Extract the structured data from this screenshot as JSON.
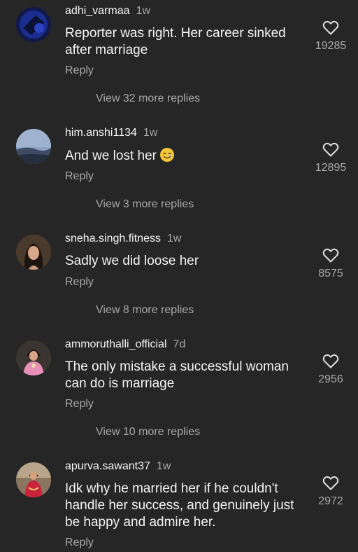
{
  "comments": [
    {
      "username": "adhi_varmaa",
      "time": "1w",
      "text": "Reporter was right. Her career sinked after marriage",
      "reply_label": "Reply",
      "likes": "19285",
      "view_more": "View 32 more replies",
      "avatar_icon": "avatar-dark-blue"
    },
    {
      "username": "him.anshi1134",
      "time": "1w",
      "text": "And we lost her",
      "emoji": "smiling-face-with-tear-emoji",
      "reply_label": "Reply",
      "likes": "12895",
      "view_more": "View 3 more replies",
      "avatar_icon": "avatar-sky"
    },
    {
      "username": "sneha.singh.fitness",
      "time": "1w",
      "text": "Sadly we did loose her",
      "reply_label": "Reply",
      "likes": "8575",
      "view_more": "View 8 more replies",
      "avatar_icon": "avatar-person"
    },
    {
      "username": "ammoruthalli_official",
      "time": "7d",
      "text": "The only mistake a successful woman can do is marriage",
      "reply_label": "Reply",
      "likes": "2956",
      "view_more": "View 10 more replies",
      "avatar_icon": "avatar-person-pink"
    },
    {
      "username": "apurva.sawant37",
      "time": "1w",
      "text": "Idk why he married her if he couldn't handle her success, and genuinely just be happy and admire her.",
      "reply_label": "Reply",
      "likes": "2972",
      "avatar_icon": "avatar-person-red"
    }
  ],
  "icons": {
    "like": "heart-outline-icon"
  },
  "colors": {
    "background": "#262626",
    "primary_text": "#f5f5f5",
    "secondary_text": "#a8a8a8"
  }
}
